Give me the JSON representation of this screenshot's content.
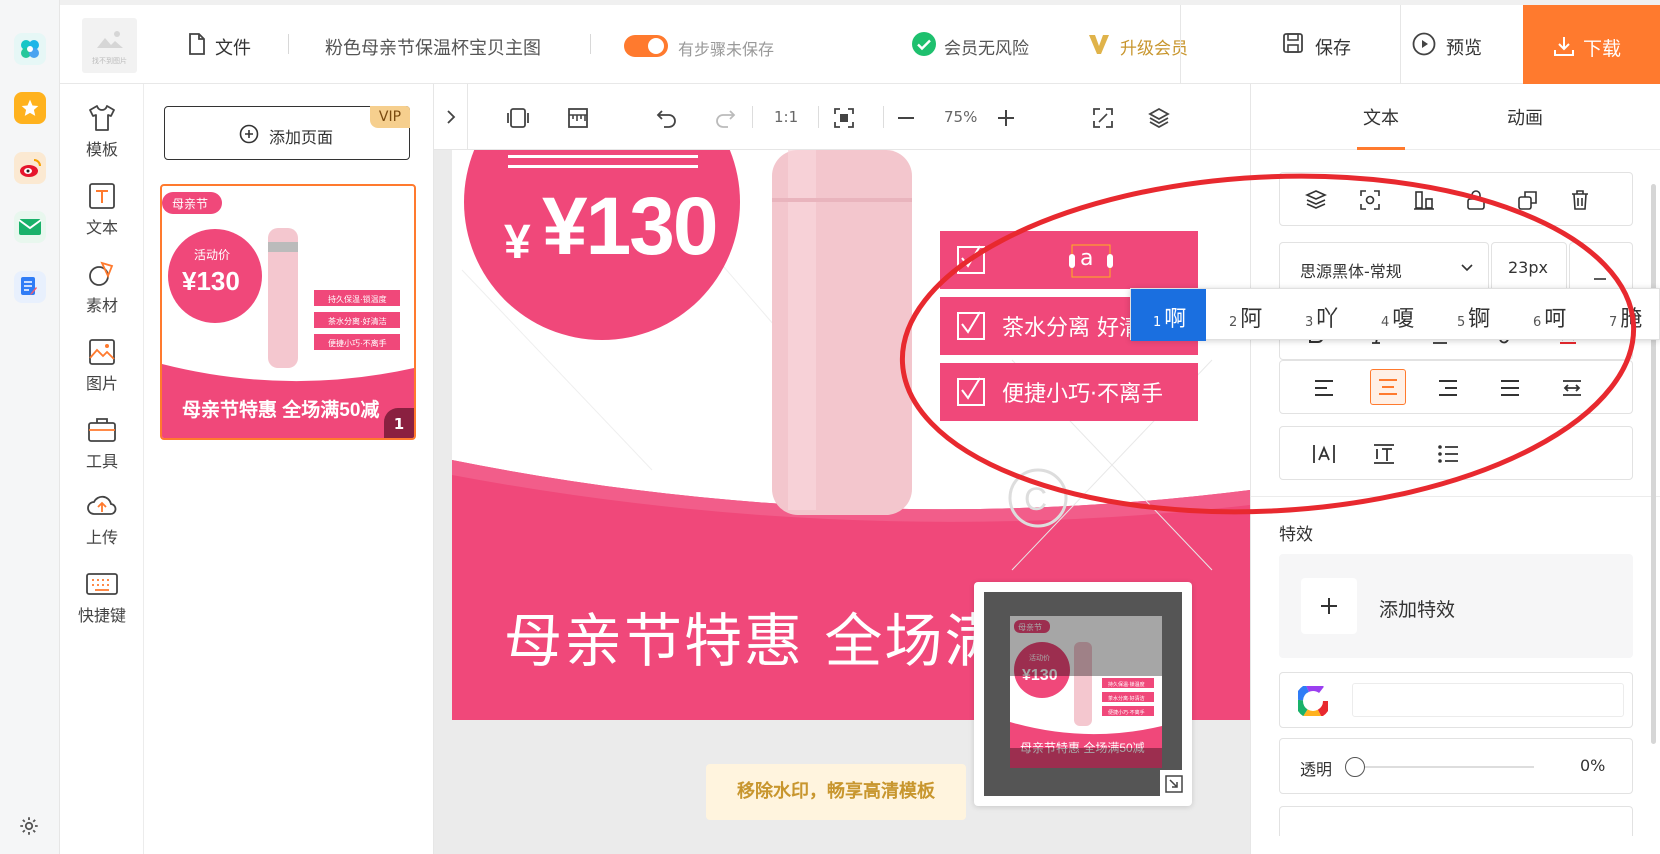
{
  "header": {
    "file_label": "文件",
    "doc_title": "粉色母亲节保温杯宝贝主图",
    "unsaved_text": "有步骤未保存",
    "member_safe": "会员无风险",
    "upgrade": "升级会员",
    "save": "保存",
    "preview": "预览",
    "download": "下载",
    "logo_caption": "找不到图片"
  },
  "rail": {
    "template": "模板",
    "text": "文本",
    "material": "素材",
    "image": "图片",
    "tools": "工具",
    "upload": "上传",
    "shortcut": "快捷键"
  },
  "pages": {
    "add_page": "添加页面",
    "vip": "VIP",
    "page_number": "1"
  },
  "canvas_toolbar": {
    "ratio": "1:1",
    "zoom": "75%"
  },
  "design": {
    "price": "¥130",
    "feature_1": "a",
    "feature_2": "茶水分离 好清洁",
    "feature_3": "便捷小巧·不离手",
    "banner": "母亲节特惠 全场满50减",
    "banner_visible": "母亲节特惠 全场满"
  },
  "thumb": {
    "tag": "母亲节",
    "promo": "活动价",
    "price": "¥130",
    "f1": "持久保温·锁温度",
    "f2": "茶水分离·好清洁",
    "f3": "便捷小巧·不离手",
    "banner": "母亲节特惠 全场满50减"
  },
  "watermark_notice": "移除水印，畅享高清模板",
  "ime_candidates": [
    {
      "n": "1",
      "c": "啊"
    },
    {
      "n": "2",
      "c": "阿"
    },
    {
      "n": "3",
      "c": "吖"
    },
    {
      "n": "4",
      "c": "嗄"
    },
    {
      "n": "5",
      "c": "锕"
    },
    {
      "n": "6",
      "c": "呵"
    },
    {
      "n": "7",
      "c": "腌"
    }
  ],
  "right_panel": {
    "tab_text": "文本",
    "tab_animation": "动画",
    "font_family": "思源黑体-常规",
    "font_size": "23px",
    "effects_title": "特效",
    "add_effect": "添加特效",
    "opacity_label": "透明",
    "opacity_value": "0%",
    "opacity": 0
  },
  "colors": {
    "accent_orange": "#ff7a2e",
    "pink": "#f0487a",
    "gold": "#c8962e",
    "annotation_red": "#e8292f"
  }
}
